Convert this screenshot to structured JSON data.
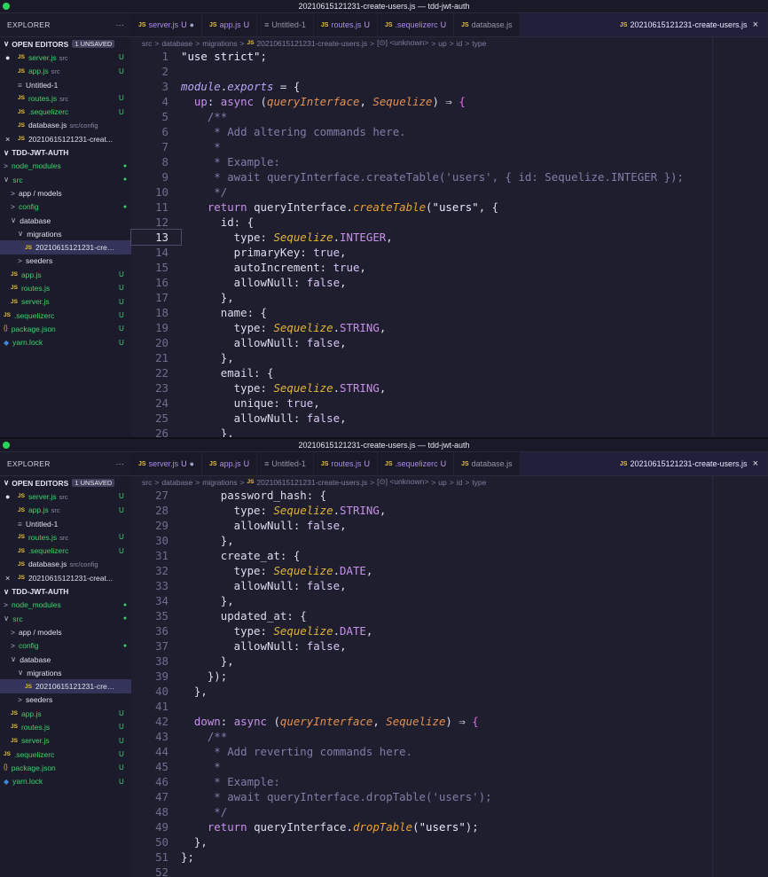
{
  "window": {
    "title": "20210615121231-create-users.js — tdd-jwt-auth"
  },
  "explorer": {
    "header": "EXPLORER",
    "more": "···",
    "open_editors_label": "OPEN EDITORS",
    "unsaved_badge": "1 UNSAVED",
    "project_label": "TDD-JWT-AUTH"
  },
  "tabs": [
    {
      "icon": "JS",
      "name": "server.js",
      "status": "U",
      "modified": "●"
    },
    {
      "icon": "JS",
      "name": "app.js",
      "status": "U"
    },
    {
      "icon": "≡",
      "name": "Untitled-1",
      "status": ""
    },
    {
      "icon": "JS",
      "name": "routes.js",
      "status": "U"
    },
    {
      "icon": "JS",
      "name": ".sequelizerc",
      "status": "U"
    },
    {
      "icon": "JS",
      "name": "database.js",
      "status": ""
    },
    {
      "icon": "JS",
      "name": "20210615121231-create-users.js",
      "status": "",
      "close": "×"
    }
  ],
  "breadcrumbs": {
    "parts": [
      "src",
      "database",
      "migrations"
    ],
    "file": "20210615121231-create-users.js",
    "symbols": [
      "[⊙] <unknown>",
      "up",
      "id",
      "type"
    ],
    "sep": ">"
  },
  "open_editors": [
    {
      "mark": "●",
      "icon": "JS",
      "name": "server.js",
      "tag": "src",
      "status": "U"
    },
    {
      "mark": "",
      "icon": "JS",
      "name": "app.js",
      "tag": "src",
      "status": "U"
    },
    {
      "mark": "",
      "icon": "≡",
      "name": "Untitled-1",
      "tag": "",
      "status": ""
    },
    {
      "mark": "",
      "icon": "JS",
      "name": "routes.js",
      "tag": "src",
      "status": "U"
    },
    {
      "mark": "",
      "icon": "JS",
      "name": ".sequelizerc",
      "tag": "",
      "status": "U"
    },
    {
      "mark": "",
      "icon": "JS",
      "name": "database.js",
      "tag": "src/config",
      "status": ""
    },
    {
      "mark": "×",
      "icon": "JS",
      "name": "20210615121231-creat...",
      "tag": "",
      "status": ""
    }
  ],
  "tree": [
    {
      "indent": 0,
      "arrow": ">",
      "name": "node_modules",
      "green": true,
      "status": "●"
    },
    {
      "indent": 0,
      "arrow": "∨",
      "name": "src",
      "green": true,
      "status": "●"
    },
    {
      "indent": 1,
      "arrow": ">",
      "name": "app / models",
      "green": false,
      "status": ""
    },
    {
      "indent": 1,
      "arrow": ">",
      "name": "config",
      "green": true,
      "status": "●"
    },
    {
      "indent": 1,
      "arrow": "∨",
      "name": "database",
      "green": false,
      "status": ""
    },
    {
      "indent": 2,
      "arrow": "∨",
      "name": "migrations",
      "green": false,
      "status": ""
    },
    {
      "indent": 3,
      "arrow": "",
      "icon": "JS",
      "name": "20210615121231-creat...",
      "green": false,
      "status": "",
      "selected": true
    },
    {
      "indent": 2,
      "arrow": ">",
      "name": "seeders",
      "green": false,
      "status": ""
    },
    {
      "indent": 1,
      "arrow": "",
      "icon": "JS",
      "name": "app.js",
      "green": true,
      "status": "U"
    },
    {
      "indent": 1,
      "arrow": "",
      "icon": "JS",
      "name": "routes.js",
      "green": true,
      "status": "U"
    },
    {
      "indent": 1,
      "arrow": "",
      "icon": "JS",
      "name": "server.js",
      "green": true,
      "status": "U"
    },
    {
      "indent": 0,
      "arrow": "",
      "icon": "JS",
      "name": ".sequelizerc",
      "green": true,
      "status": "U"
    },
    {
      "indent": 0,
      "arrow": "",
      "icon": "{}",
      "name": "package.json",
      "green": true,
      "status": "U"
    },
    {
      "indent": 0,
      "arrow": "",
      "icon": "yarn",
      "name": "yarn.lock",
      "green": true,
      "status": "U"
    }
  ],
  "code_top": [
    {
      "n": 1,
      "t": "\"use strict\";"
    },
    {
      "n": 2,
      "t": ""
    },
    {
      "n": 3,
      "t": "module.exports = {"
    },
    {
      "n": 4,
      "t": "  up: async (queryInterface, Sequelize) ⇒ {"
    },
    {
      "n": 5,
      "t": "    /**"
    },
    {
      "n": 6,
      "t": "     * Add altering commands here."
    },
    {
      "n": 7,
      "t": "     *"
    },
    {
      "n": 8,
      "t": "     * Example:"
    },
    {
      "n": 9,
      "t": "     * await queryInterface.createTable('users', { id: Sequelize.INTEGER });"
    },
    {
      "n": 10,
      "t": "     */"
    },
    {
      "n": 11,
      "t": "    return queryInterface.createTable(\"users\", {"
    },
    {
      "n": 12,
      "t": "      id: {"
    },
    {
      "n": 13,
      "t": "        type: Sequelize.INTEGER,"
    },
    {
      "n": 14,
      "t": "        primaryKey: true,"
    },
    {
      "n": 15,
      "t": "        autoIncrement: true,"
    },
    {
      "n": 16,
      "t": "        allowNull: false,"
    },
    {
      "n": 17,
      "t": "      },"
    },
    {
      "n": 18,
      "t": "      name: {"
    },
    {
      "n": 19,
      "t": "        type: Sequelize.STRING,"
    },
    {
      "n": 20,
      "t": "        allowNull: false,"
    },
    {
      "n": 21,
      "t": "      },"
    },
    {
      "n": 22,
      "t": "      email: {"
    },
    {
      "n": 23,
      "t": "        type: Sequelize.STRING,"
    },
    {
      "n": 24,
      "t": "        unique: true,"
    },
    {
      "n": 25,
      "t": "        allowNull: false,"
    },
    {
      "n": 26,
      "t": "      },"
    }
  ],
  "code_bottom": [
    {
      "n": 27,
      "t": "      password_hash: {"
    },
    {
      "n": 28,
      "t": "        type: Sequelize.STRING,"
    },
    {
      "n": 29,
      "t": "        allowNull: false,"
    },
    {
      "n": 30,
      "t": "      },"
    },
    {
      "n": 31,
      "t": "      create_at: {"
    },
    {
      "n": 32,
      "t": "        type: Sequelize.DATE,"
    },
    {
      "n": 33,
      "t": "        allowNull: false,"
    },
    {
      "n": 34,
      "t": "      },"
    },
    {
      "n": 35,
      "t": "      updated_at: {"
    },
    {
      "n": 36,
      "t": "        type: Sequelize.DATE,"
    },
    {
      "n": 37,
      "t": "        allowNull: false,"
    },
    {
      "n": 38,
      "t": "      },"
    },
    {
      "n": 39,
      "t": "    });"
    },
    {
      "n": 40,
      "t": "  },"
    },
    {
      "n": 41,
      "t": ""
    },
    {
      "n": 42,
      "t": "  down: async (queryInterface, Sequelize) ⇒ {"
    },
    {
      "n": 43,
      "t": "    /**"
    },
    {
      "n": 44,
      "t": "     * Add reverting commands here."
    },
    {
      "n": 45,
      "t": "     *"
    },
    {
      "n": 46,
      "t": "     * Example:"
    },
    {
      "n": 47,
      "t": "     * await queryInterface.dropTable('users');"
    },
    {
      "n": 48,
      "t": "     */"
    },
    {
      "n": 49,
      "t": "    return queryInterface.dropTable(\"users\");"
    },
    {
      "n": 50,
      "t": "  },"
    },
    {
      "n": 51,
      "t": "};"
    },
    {
      "n": 52,
      "t": ""
    }
  ],
  "cursor_line": 13
}
